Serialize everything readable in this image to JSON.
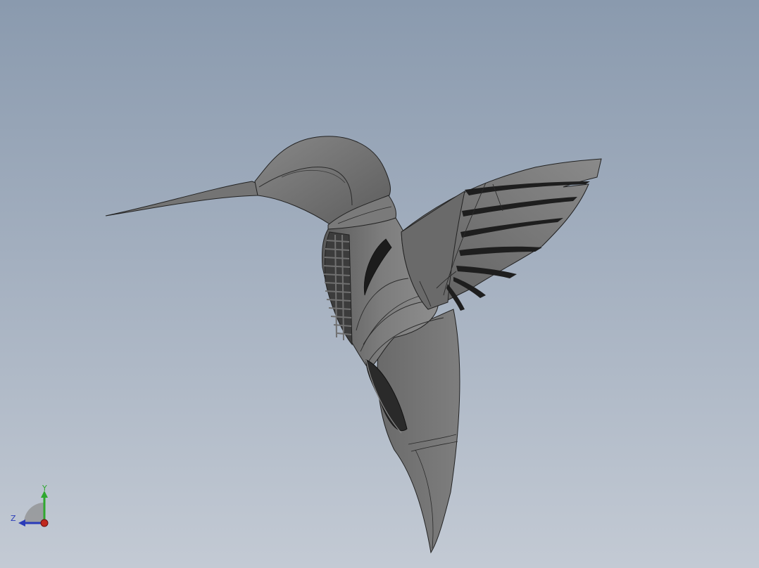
{
  "viewport": {
    "background_top": "#8a9aae",
    "background_bottom": "#c3cad4",
    "model_name": "hummingbird"
  },
  "triad": {
    "y_label": "Y",
    "z_label": "Z",
    "colors": {
      "y_axis": "#2fa82f",
      "z_axis": "#2a3bb8",
      "x_axis": "#c0281e"
    }
  }
}
